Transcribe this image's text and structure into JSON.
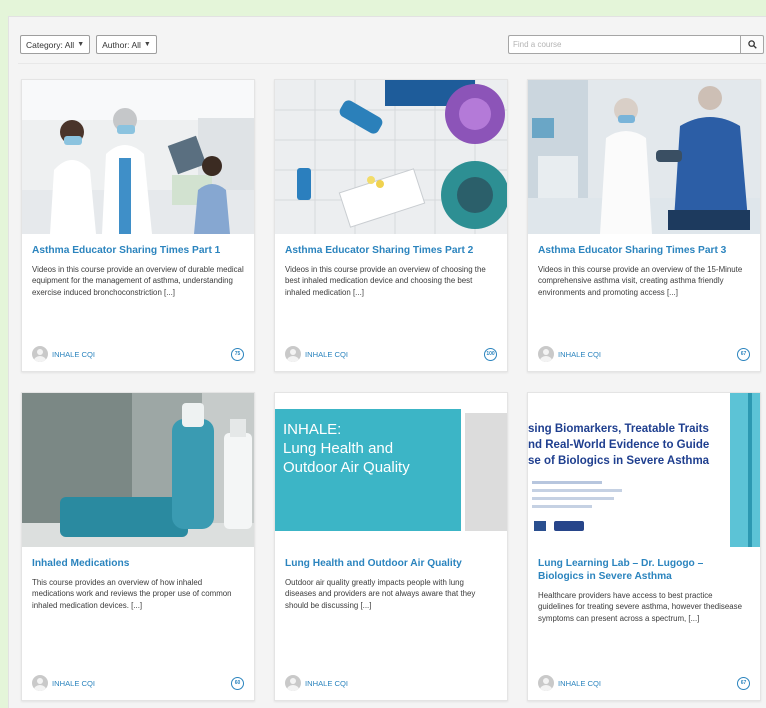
{
  "filters": {
    "category_label": "Category: All",
    "author_label": "Author: All"
  },
  "search": {
    "placeholder": "Find a course",
    "icon": "search-icon"
  },
  "edge_glyph": "\\",
  "courses": [
    {
      "title": "Asthma Educator Sharing Times Part 1",
      "description": "Videos in this course provide an overview of durable medical equipment for the management of asthma, understanding exercise induced bronchoconstriction [...]",
      "author": "INHALE CQI",
      "badge": "75"
    },
    {
      "title": "Asthma Educator Sharing Times Part 2",
      "description": "Videos in this course provide an overview of choosing the best inhaled medication device and choosing the best inhaled medication [...]",
      "author": "INHALE CQI",
      "badge": "100"
    },
    {
      "title": "Asthma Educator Sharing Times Part 3",
      "description": "Videos in this course provide an overview of the 15-Minute comprehensive asthma visit, creating asthma friendly environments and promoting access [...]",
      "author": "INHALE CQI",
      "badge": "67"
    },
    {
      "title": "Inhaled Medications",
      "description": "This course provides an overview of how inhaled medications work and reviews the proper use of common inhaled medication devices. [...]",
      "author": "INHALE CQI",
      "badge": "60"
    },
    {
      "title": "Lung Health and Outdoor Air Quality",
      "description": "Outdoor air quality greatly impacts people with lung diseases and providers are not always aware that they should be discussing [...]",
      "author": "INHALE CQI",
      "badge": "",
      "cover_text": "INHALE:\nLung Health and\nOutdoor Air Quality"
    },
    {
      "title": "Lung Learning Lab – Dr. Lugogo – Biologics in Severe Asthma",
      "description": "Healthcare providers have access to best practice guidelines for treating severe asthma, however thedisease symptoms can present across a spectrum, [...]",
      "author": "INHALE CQI",
      "badge": "67",
      "cover_text": "sing Biomarkers, Treatable Traits\nnd Real-World Evidence to Guide\nse of Biologics in Severe Asthma"
    }
  ]
}
